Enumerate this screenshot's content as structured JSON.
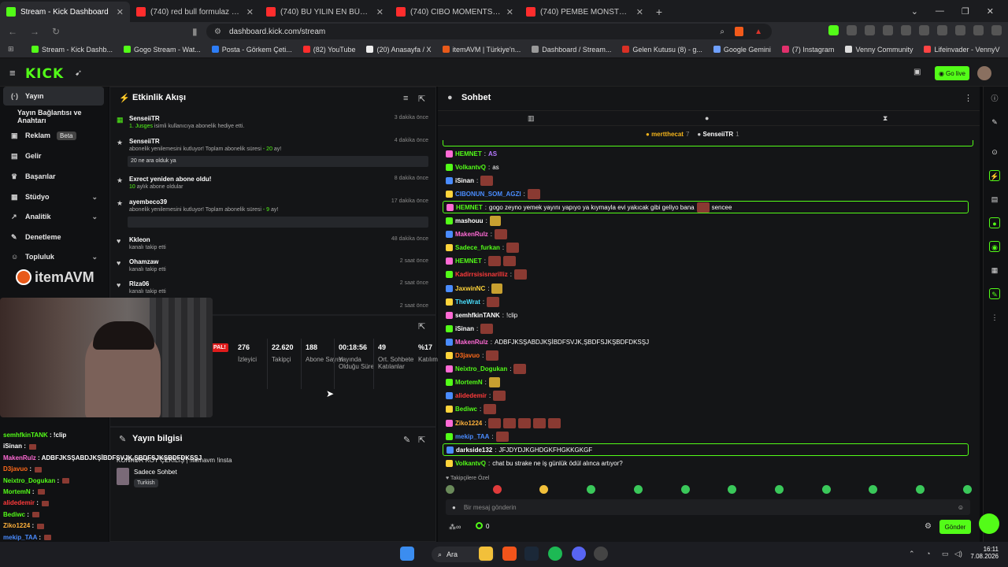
{
  "browser": {
    "tabs": [
      {
        "title": "Stream - Kick Dashboard",
        "fav": "#53fc18",
        "active": true
      },
      {
        "title": "(740) red bull formulaz + rize vlog -",
        "fav": "#ff2d2d"
      },
      {
        "title": "(740) BU YILIN EN BÜYÜK DRAMASI",
        "fav": "#ff2d2d"
      },
      {
        "title": "(740) CİBO MOMENTS | ULTRA HIZLI",
        "fav": "#ff2d2d"
      },
      {
        "title": "(740) PEMBE MONSTER | Madara Olu",
        "fav": "#ff2d2d"
      }
    ],
    "new_tab": "+",
    "url": "dashboard.kick.com/stream",
    "bookmarks": [
      {
        "label": "Stream - Kick Dashb...",
        "color": "#53fc18"
      },
      {
        "label": "Gogo Stream - Wat...",
        "color": "#53fc18"
      },
      {
        "label": "Posta - Görkem Çeti...",
        "color": "#2d7df6"
      },
      {
        "label": "(82) YouTube",
        "color": "#ff2d2d"
      },
      {
        "label": "(20) Anasayfa / X",
        "color": "#eeeeee"
      },
      {
        "label": "itemAVM | Türkiye'n...",
        "color": "#e85a1a"
      },
      {
        "label": "Dashboard / Stream...",
        "color": "#9a9a9a"
      },
      {
        "label": "Gelen Kutusu (8) - g...",
        "color": "#d93025"
      },
      {
        "label": "Google Gemini",
        "color": "#6fa0ff"
      },
      {
        "label": "(7) Instagram",
        "color": "#e1306c"
      },
      {
        "label": "Venny Community",
        "color": "#dddddd"
      },
      {
        "label": "Lifeinvader - VennyV",
        "color": "#ff4444"
      }
    ]
  },
  "header": {
    "logo": "KICK",
    "go_live": "Go live"
  },
  "sidebar": {
    "items": [
      {
        "label": "Yayın",
        "icon": "(·)",
        "active": true
      },
      {
        "label": "Yayın Bağlantısı ve Anahtarı",
        "icon": ""
      },
      {
        "label": "Reklam",
        "icon": "▣",
        "badge": "Beta"
      },
      {
        "label": "Gelir",
        "icon": "▤"
      },
      {
        "label": "Başarılar",
        "icon": "♛"
      },
      {
        "label": "Stüdyo",
        "icon": "▦",
        "chev": "⌄"
      },
      {
        "label": "Analitik",
        "icon": "↗",
        "chev": "⌄"
      },
      {
        "label": "Denetleme",
        "icon": "✎"
      },
      {
        "label": "Topluluk",
        "icon": "☺",
        "chev": "⌄"
      }
    ],
    "overlay_brand": "itemAVM"
  },
  "events": {
    "title": "Etkinlik Akışı",
    "items": [
      {
        "icon": "▦",
        "name": "SenseiiTR",
        "sub": "1. Jusges isimli kullanıcıya abonelik hediye etti.",
        "time": "3 dakika önce"
      },
      {
        "icon": "★",
        "name": "SenseiiTR",
        "sub": "abonelik yenilemesini kutluyor! Toplam abonelik süresi - 20 ay!",
        "time": "4 dakika önce",
        "note": "20 ne ara olduk ya"
      },
      {
        "icon": "★",
        "name": "Exrect yeniden abone oldu!",
        "sub": "10 aylık abone oldular",
        "time": "8 dakika önce"
      },
      {
        "icon": "★",
        "name": "ayembeco39",
        "sub": "abonelik yenilemesini kutluyor! Toplam abonelik süresi - 9 ay!",
        "time": "17 dakika önce",
        "note": " "
      },
      {
        "icon": "♥",
        "name": "Kkleon",
        "sub": "kanalı takip etti",
        "time": "48 dakika önce"
      },
      {
        "icon": "♥",
        "name": "Ohamzaw",
        "sub": "kanalı takip etti",
        "time": "2 saat önce"
      },
      {
        "icon": "♥",
        "name": "Rlza06",
        "sub": "kanalı takip etti",
        "time": "2 saat önce"
      },
      {
        "icon": "",
        "name": "",
        "sub": "",
        "time": "2 saat önce"
      }
    ]
  },
  "stats": {
    "live_badge": "PAL!",
    "items": [
      {
        "value": "",
        "label": "İzleyici"
      },
      {
        "value": "276",
        "label": "İzleyici"
      },
      {
        "value": "22.620",
        "label": "Takipçi"
      },
      {
        "value": "188",
        "label": "Abone Sayısı"
      },
      {
        "value": "00:18:56",
        "label": "Yayında Olduğu Süre"
      },
      {
        "value": "49",
        "label": "Ort. Sohbete Katılanlar"
      },
      {
        "value": "%17",
        "label": "Katılım"
      }
    ]
  },
  "stream_info": {
    "title": "Yayın bilgisi",
    "stream_title": "KONKUR KOY ÇEKİLİŞ | !itemavm !insta",
    "category": "Sadece Sohbet",
    "tag": "Turkish"
  },
  "chat": {
    "title": "Sohbet",
    "pinned_users": [
      {
        "name": "mertthecat",
        "count": "7"
      },
      {
        "name": "SenseiiTR",
        "count": "1"
      }
    ],
    "messages": [
      {
        "user": "HEMNET",
        "color": "#53fc18",
        "msg": "",
        "emote": "AS"
      },
      {
        "user": "VolkantvQ",
        "color": "#53fc18",
        "msg": "as"
      },
      {
        "user": "iSinan",
        "color": "#ffffff",
        "msg": "",
        "emotes": 1
      },
      {
        "user": "CIBONUN_SOM_AGZI",
        "color": "#4a8cff",
        "msg": "",
        "emotes": 1
      },
      {
        "user": "HEMNET",
        "color": "#53fc18",
        "msg": "gogo zeyno yemek yayını yapıyo ya kıymayla evi yakıcak gibi geliyo bana",
        "emotes": 1,
        "tail": "sencee",
        "pinned": true
      },
      {
        "user": "mashouu",
        "color": "#ffffff",
        "msg": "",
        "emotes": 1
      },
      {
        "user": "MakenRulz",
        "color": "#ff6ad5",
        "msg": "",
        "emotes": 1
      },
      {
        "user": "Sadece_furkan",
        "color": "#53fc18",
        "msg": "",
        "emotes": 1
      },
      {
        "user": "HEMNET",
        "color": "#53fc18",
        "msg": "",
        "emotes": 2
      },
      {
        "user": "Kadirrsisisnarilliz",
        "color": "#ff3b3b",
        "msg": "",
        "emotes": 1
      },
      {
        "user": "JaxwinNC",
        "color": "#ffd43b",
        "msg": "",
        "emotes": 1
      },
      {
        "user": "TheWrat",
        "color": "#4ae0ff",
        "msg": "",
        "emotes": 1
      },
      {
        "user": "semhfkinTANK",
        "color": "#ffffff",
        "msg": "!clip"
      },
      {
        "user": "iSinan",
        "color": "#ffffff",
        "msg": "",
        "emotes": 1
      },
      {
        "user": "MakenRulz",
        "color": "#ff6ad5",
        "msg": "ADBFJKSŞABDJKŞİBDFSVJK,ŞBDFSJKŞBDFDKSŞJ"
      },
      {
        "user": "D3javuo",
        "color": "#ff6a1a",
        "msg": "",
        "emotes": 1
      },
      {
        "user": "Neixtro_Dogukan",
        "color": "#53fc18",
        "msg": "",
        "emotes": 1
      },
      {
        "user": "MortemN",
        "color": "#53fc18",
        "msg": "",
        "emotes": 1
      },
      {
        "user": "alidedemir",
        "color": "#ff3b3b",
        "msg": "",
        "emotes": 1
      },
      {
        "user": "Bediwc",
        "color": "#53fc18",
        "msg": "",
        "emotes": 1
      },
      {
        "user": "Ziko1224",
        "color": "#ffb13b",
        "msg": "",
        "emotes": 5
      },
      {
        "user": "mekip_TAA",
        "color": "#4a8cff",
        "msg": "",
        "emotes": 1
      },
      {
        "user": "darkside132",
        "color": "#ffffff",
        "msg": "JFJDYDJKGHDGKFHGKKGKGF",
        "pinned": true
      },
      {
        "user": "VolkantvQ",
        "color": "#53fc18",
        "msg": "chat bu strake ne iş günlük ödül alınca artıyor?"
      }
    ],
    "followers_only": "♥ Takipçilere Özel",
    "input_placeholder": "Bir mesaj gönderin",
    "points": "0",
    "send_label": "Gönder"
  },
  "overlay_chat": [
    {
      "user": "semhfkinTANK",
      "color": "#53fc18",
      "msg": "!clip"
    },
    {
      "user": "iSinan",
      "color": "#ffffff",
      "msg": ""
    },
    {
      "user": "MakenRulz",
      "color": "#ff6ad5",
      "msg": "ADBFJKSŞABDJKŞİBDFSVJK,ŞBDFSJKŞBDFDKSŞJ"
    },
    {
      "user": "D3javuo",
      "color": "#ff6a1a",
      "msg": ""
    },
    {
      "user": "Neixtro_Dogukan",
      "color": "#53fc18",
      "msg": ""
    },
    {
      "user": "MortemN",
      "color": "#53fc18",
      "msg": ""
    },
    {
      "user": "alidedemir",
      "color": "#ff3b3b",
      "msg": ""
    },
    {
      "user": "Bediwc",
      "color": "#53fc18",
      "msg": ""
    },
    {
      "user": "Ziko1224",
      "color": "#ffb13b",
      "msg": ""
    },
    {
      "user": "mekip_TAA",
      "color": "#4a8cff",
      "msg": ""
    },
    {
      "user": "darkside132",
      "color": "#ffffff",
      "msg": "JFJDYDJKGHDGKFHGKKGKGF"
    }
  ],
  "taskbar": {
    "search": "Ara",
    "time": "16:11",
    "date": "7.08.2026"
  }
}
